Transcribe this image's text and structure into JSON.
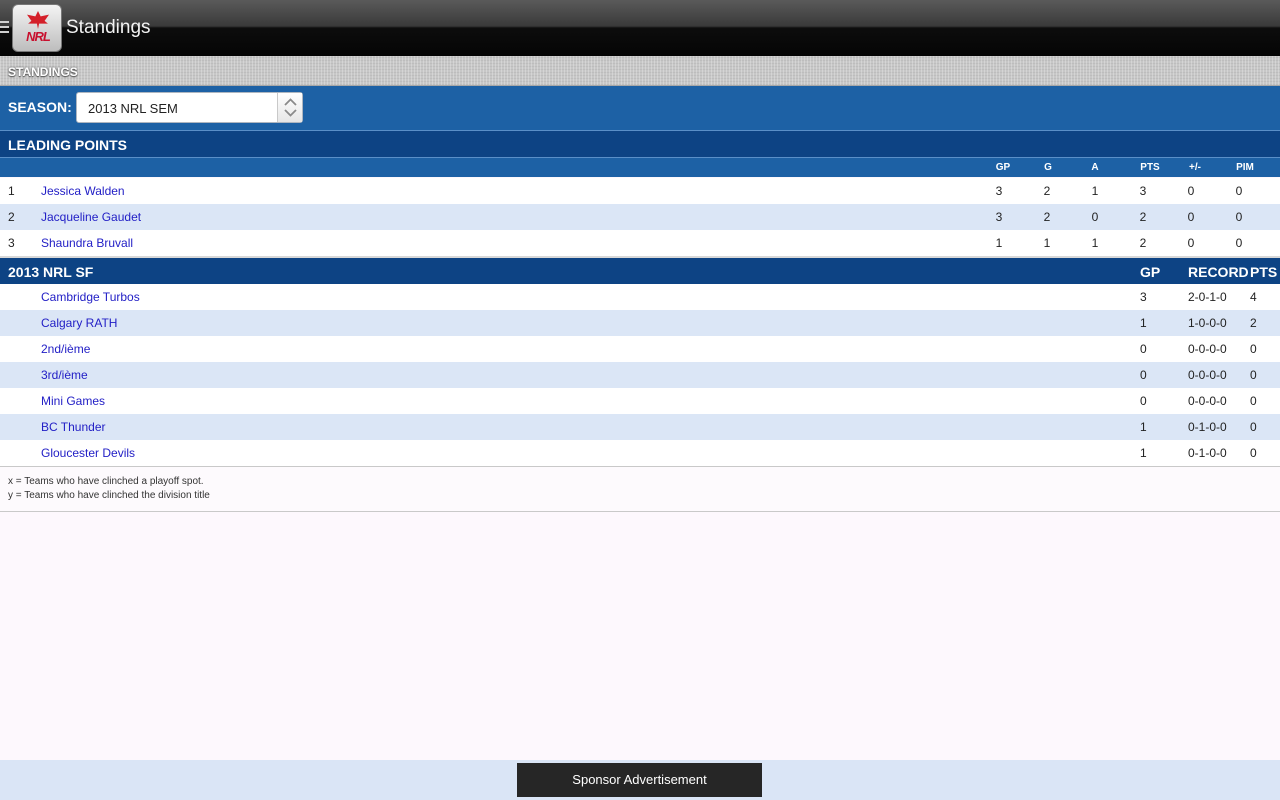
{
  "app": {
    "title": "Standings"
  },
  "section": {
    "title": "STANDINGS"
  },
  "season": {
    "label": "SEASON:",
    "selected": "2013 NRL SEM"
  },
  "leading_points": {
    "title": "LEADING POINTS",
    "columns": [
      "GP",
      "G",
      "A",
      "PTS",
      "+/-",
      "PIM"
    ],
    "rows": [
      {
        "rank": "1",
        "name": "Jessica Walden",
        "gp": "3",
        "g": "2",
        "a": "1",
        "pts": "3",
        "pm": "0",
        "pim": "0"
      },
      {
        "rank": "2",
        "name": "Jacqueline Gaudet",
        "gp": "3",
        "g": "2",
        "a": "0",
        "pts": "2",
        "pm": "0",
        "pim": "0"
      },
      {
        "rank": "3",
        "name": "Shaundra Bruvall",
        "gp": "1",
        "g": "1",
        "a": "1",
        "pts": "2",
        "pm": "0",
        "pim": "0"
      }
    ]
  },
  "division": {
    "title": "2013 NRL SF",
    "columns": [
      "GP",
      "RECORD",
      "PTS"
    ],
    "rows": [
      {
        "team": "Cambridge Turbos",
        "gp": "3",
        "record": "2-0-1-0",
        "pts": "4"
      },
      {
        "team": "Calgary RATH",
        "gp": "1",
        "record": "1-0-0-0",
        "pts": "2"
      },
      {
        "team": "2nd/ième",
        "gp": "0",
        "record": "0-0-0-0",
        "pts": "0"
      },
      {
        "team": "3rd/ième",
        "gp": "0",
        "record": "0-0-0-0",
        "pts": "0"
      },
      {
        "team": "Mini Games",
        "gp": "0",
        "record": "0-0-0-0",
        "pts": "0"
      },
      {
        "team": "BC Thunder",
        "gp": "1",
        "record": "0-1-0-0",
        "pts": "0"
      },
      {
        "team": "Gloucester Devils",
        "gp": "1",
        "record": "0-1-0-0",
        "pts": "0"
      }
    ]
  },
  "legend": {
    "x": "x = Teams who have clinched a playoff spot.",
    "y": "y = Teams who have clinched the division title"
  },
  "footer": {
    "ad_label": "Sponsor Advertisement"
  },
  "logo_text": "NRL",
  "colors": {
    "header_blue": "#1d61a5",
    "title_blue": "#0d4384",
    "link_blue": "#2320c6",
    "alt_row": "#dbe6f6"
  },
  "icons": {
    "menu": "menu-icon",
    "logo": "app-logo",
    "select": "spinner-arrows-icon"
  }
}
